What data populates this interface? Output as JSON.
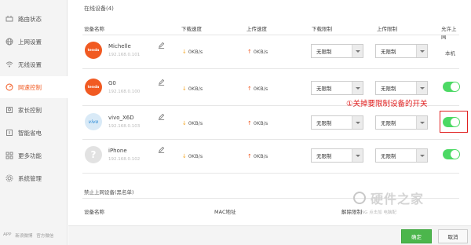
{
  "sidebar": {
    "items": [
      {
        "label": "路由状态",
        "icon": "router-icon",
        "active": false
      },
      {
        "label": "上网设置",
        "icon": "globe-icon",
        "active": false
      },
      {
        "label": "无线设置",
        "icon": "wifi-icon",
        "active": false
      },
      {
        "label": "网速控制",
        "icon": "speedometer-icon",
        "active": true
      },
      {
        "label": "家长控制",
        "icon": "parent-icon",
        "active": false
      },
      {
        "label": "智能省电",
        "icon": "power-icon",
        "active": false
      },
      {
        "label": "更多功能",
        "icon": "grid-icon",
        "active": false
      },
      {
        "label": "系统管理",
        "icon": "gear-icon",
        "active": false
      }
    ],
    "footer": [
      "APP",
      "新浪微博",
      "官方微信"
    ]
  },
  "online": {
    "title": "在线设备(4)",
    "columns": {
      "device": "设备名称",
      "down_speed": "下载速度",
      "up_speed": "上传速度",
      "down_limit": "下载限制",
      "up_limit": "上传限制",
      "allow": "允许上网"
    },
    "devices": [
      {
        "name": "Michelle",
        "ip": "192.168.0.101",
        "avatar": "tenda",
        "down": "0KB/s",
        "up": "0KB/s",
        "down_limit": "无限制",
        "up_limit": "无限制",
        "allow_text": "本机"
      },
      {
        "name": "G0",
        "ip": "192.168.0.100",
        "avatar": "tenda",
        "down": "0KB/s",
        "up": "0KB/s",
        "down_limit": "无限制",
        "up_limit": "无限制",
        "allow": true
      },
      {
        "name": "vivo_X6D",
        "ip": "192.168.0.103",
        "avatar": "vivo",
        "down": "0KB/s",
        "up": "0KB/s",
        "down_limit": "无限制",
        "up_limit": "无限制",
        "allow": true
      },
      {
        "name": "iPhone",
        "ip": "192.168.0.102",
        "avatar": "unknown",
        "down": "0KB/s",
        "up": "0KB/s",
        "down_limit": "无限制",
        "up_limit": "无限制",
        "allow": true
      }
    ],
    "avatar_labels": {
      "tenda": "tenda",
      "vivo": "vivo",
      "unknown": "?"
    }
  },
  "annotation": {
    "text": "①关掉要限制设备的开关",
    "color": "#e02020"
  },
  "blacklist": {
    "title": "禁止上网设备(黑名单)",
    "columns": {
      "device": "设备名称",
      "mac": "MAC地址",
      "action": "解除限制"
    }
  },
  "buttons": {
    "ok": "确定",
    "cancel": "取消"
  },
  "watermark": {
    "logo_text": "硬件之家",
    "sub": "YING 点击加 电脑配",
    "sub_red": "硬件之家"
  },
  "colors": {
    "accent": "#f15a22",
    "toggle_on": "#4cd964",
    "ok_button": "#4cb64c"
  }
}
